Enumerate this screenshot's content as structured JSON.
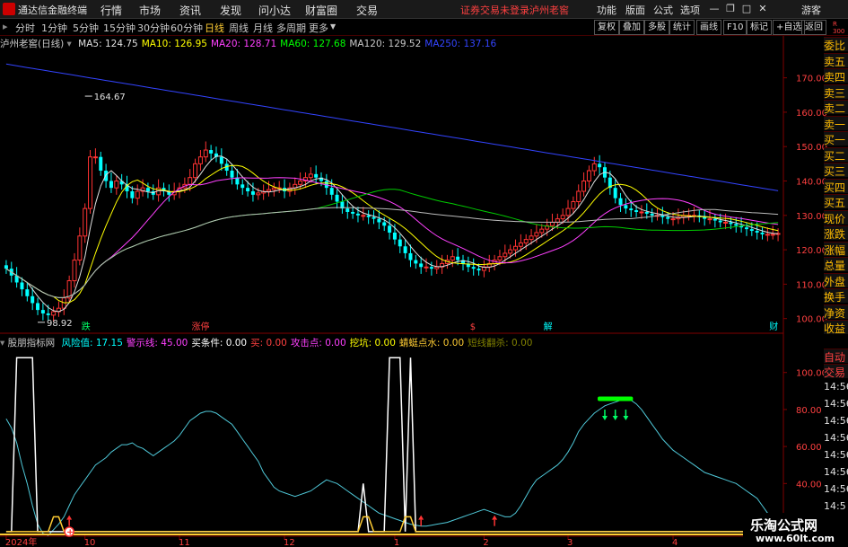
{
  "app": {
    "title": "通达信金融终端"
  },
  "menu": [
    "行情",
    "市场",
    "资讯",
    "发现",
    "问小达",
    "财富圈",
    "交易"
  ],
  "warning": {
    "text": "证券交易未登录",
    "stock": "泸州老窖"
  },
  "right_menu": [
    "功能",
    "版面",
    "公式",
    "选项"
  ],
  "user": "游客",
  "periods": [
    "分时",
    "1分钟",
    "5分钟",
    "15分钟",
    "30分钟",
    "60分钟",
    "日线",
    "周线",
    "月线",
    "多周期",
    "更多"
  ],
  "active_period": "日线",
  "tools": [
    "复权",
    "叠加",
    "多股",
    "统计",
    "画线",
    "F10",
    "标记",
    "+自选",
    "返回"
  ],
  "main_title": {
    "stock": "泸州老窖(日线)",
    "ma": [
      {
        "label": "MA5: 124.75",
        "color": "#e0e0e0"
      },
      {
        "label": "MA10: 126.95",
        "color": "#ffff00"
      },
      {
        "label": "MA20: 128.71",
        "color": "#ff40ff"
      },
      {
        "label": "MA60: 127.68",
        "color": "#00ff00"
      },
      {
        "label": "MA120: 129.52",
        "color": "#c8c8c8"
      },
      {
        "label": "MA250: 137.16",
        "color": "#3344ff"
      }
    ]
  },
  "indicator_title": {
    "name": "股朋指标网",
    "items": [
      {
        "label": "风险值: 17.15",
        "color": "#00ffff"
      },
      {
        "label": "警示线: 45.00",
        "color": "#ff40ff"
      },
      {
        "label": "买条件: 0.00",
        "color": "#ffffff"
      },
      {
        "label": "买: 0.00",
        "color": "#ff4040"
      },
      {
        "label": "攻击点: 0.00",
        "color": "#ff40ff"
      },
      {
        "label": "挖坑: 0.00",
        "color": "#ffff00"
      },
      {
        "label": "蜻蜓点水: 0.00",
        "color": "#ffcc33"
      },
      {
        "label": "短线翻杀: 0.00",
        "color": "#808000"
      }
    ]
  },
  "right_panel": [
    "委比",
    "卖五",
    "卖四",
    "卖三",
    "卖二",
    "卖一",
    "买一",
    "买二",
    "买三",
    "买四",
    "买五",
    "现价",
    "涨跌",
    "涨幅",
    "总量",
    "外盘",
    "换手",
    "净资",
    "收益",
    "自动",
    "交易"
  ],
  "right_panel_red": "R 300",
  "right_times": [
    "14:56",
    "14:56",
    "14:56",
    "14:56",
    "14:56",
    "14:56",
    "14:56",
    "14:5"
  ],
  "brand": {
    "name": "乐淘公式网",
    "url": "www.60lt.com"
  },
  "chart_data": [
    {
      "type": "candlestick",
      "title": "泸州老窖(日线)",
      "ylim": [
        96,
        178
      ],
      "yticks": [
        100.0,
        110.0,
        120.0,
        130.0,
        140.0,
        150.0,
        160.0,
        170.0
      ],
      "x_labels": [
        {
          "text": "2024年",
          "index": 0
        },
        {
          "text": "10",
          "index": 15
        },
        {
          "text": "11",
          "index": 33
        },
        {
          "text": "12",
          "index": 53
        },
        {
          "text": "1",
          "index": 74
        },
        {
          "text": "2",
          "index": 91
        },
        {
          "text": "3",
          "index": 107
        },
        {
          "text": "4",
          "index": 127
        }
      ],
      "annotations": [
        {
          "text": "164.67",
          "index": 15
        },
        {
          "text": "98.92",
          "index": 6
        }
      ],
      "markers": [
        {
          "text": "跌",
          "index": 15,
          "color": "#00ff66"
        },
        {
          "text": "涨停",
          "index": 36,
          "color": "#ff4040"
        },
        {
          "text": "$",
          "index": 89,
          "color": "#ff4040"
        },
        {
          "text": "解",
          "index": 103,
          "color": "#00ffff"
        },
        {
          "text": "财",
          "index": 146,
          "color": "#00ffff"
        }
      ],
      "closes": [
        114.5,
        112.5,
        110.5,
        108.5,
        106.5,
        104.5,
        102.5,
        101.5,
        101,
        102,
        103,
        106,
        111,
        117,
        124,
        132,
        147,
        147,
        143,
        140,
        138,
        140,
        139,
        137,
        135,
        137,
        138,
        137,
        136,
        138,
        137,
        136,
        137,
        138,
        139,
        141,
        145,
        147,
        149,
        148,
        147,
        145,
        143,
        141,
        139,
        138,
        137,
        136,
        136.5,
        137,
        137.5,
        138,
        138,
        137,
        138,
        139,
        140,
        141,
        142,
        141,
        140,
        138,
        136,
        134,
        132,
        131,
        130.5,
        130,
        130,
        129.5,
        129,
        128,
        127,
        125,
        123,
        121,
        119,
        117,
        116,
        115,
        115,
        114.5,
        115,
        116,
        117,
        118,
        117,
        116,
        115,
        114.5,
        114,
        115,
        116,
        117,
        118,
        119,
        120,
        121,
        122,
        123,
        124,
        125,
        126,
        127,
        128,
        129,
        130,
        132,
        134,
        137,
        140,
        143,
        145,
        144,
        141,
        138,
        135,
        133,
        132,
        131.5,
        131,
        131,
        130.5,
        130,
        130,
        129.5,
        129,
        129,
        129.5,
        130,
        130,
        130,
        129.5,
        129,
        129,
        128.5,
        128,
        128,
        127.5,
        127,
        126.5,
        126,
        125.5,
        125,
        124.5,
        124.5,
        124.5,
        124.75
      ]
    },
    {
      "type": "line",
      "title": "股朋指标网",
      "ylim": [
        12,
        112
      ],
      "yticks": [
        20.0,
        40.0,
        60.0,
        80.0,
        100.0
      ],
      "series": [
        {
          "name": "风险值",
          "color": "#4fc8d8",
          "values": [
            75,
            70,
            62,
            50,
            40,
            28,
            18,
            13,
            12,
            15,
            18,
            22,
            28,
            34,
            38,
            42,
            46,
            50,
            52,
            54,
            57,
            59,
            61,
            61,
            62,
            60,
            59,
            57,
            55,
            57,
            59,
            61,
            63,
            66,
            70,
            74,
            76,
            78,
            79,
            79,
            78,
            76,
            74,
            72,
            68,
            64,
            60,
            56,
            52,
            46,
            42,
            38,
            36,
            35,
            34,
            33,
            34,
            35,
            36,
            38,
            40,
            42,
            41,
            40,
            38,
            36,
            34,
            32,
            30,
            28,
            26,
            24,
            23,
            22,
            21,
            20,
            19,
            18,
            17.5,
            17,
            17,
            17.5,
            18,
            18.5,
            19,
            20,
            21,
            22,
            23,
            24,
            25,
            26,
            25,
            24,
            23,
            22,
            22,
            24,
            28,
            33,
            38,
            42,
            44,
            46,
            48,
            50,
            53,
            57,
            62,
            68,
            72,
            75,
            78,
            80,
            82,
            83,
            84,
            85,
            86,
            85,
            83,
            80,
            76,
            72,
            68,
            64,
            61,
            58,
            56,
            54,
            52,
            50,
            48,
            46,
            45,
            44,
            43,
            42,
            41,
            40,
            38,
            36,
            34,
            32,
            28,
            24,
            20,
            18,
            17.15
          ]
        },
        {
          "name": "警示线",
          "color": "#ffffff",
          "values": [
            0,
            0,
            0,
            0,
            0,
            0,
            0,
            0,
            0,
            0,
            0,
            0,
            0,
            0,
            0,
            0,
            0,
            0,
            0,
            0,
            0,
            0,
            0,
            0,
            0,
            0,
            0,
            0,
            0,
            0,
            0,
            0,
            0,
            0,
            0,
            0,
            0,
            0,
            0,
            0,
            0,
            0,
            0,
            0,
            0,
            0,
            0,
            0,
            0,
            0,
            0,
            0,
            0,
            0,
            0,
            0,
            0,
            0,
            0,
            0,
            0,
            0,
            0,
            0,
            0,
            0,
            0,
            0,
            0,
            0,
            0,
            0,
            0,
            0,
            0,
            0,
            0,
            0,
            0,
            0,
            0,
            0,
            0,
            0,
            0,
            0,
            0,
            0,
            0,
            0,
            0,
            0,
            0,
            0,
            0,
            0,
            0,
            0,
            0,
            0,
            0,
            0,
            0,
            0,
            0,
            0,
            0,
            0,
            0,
            0,
            0,
            0,
            0,
            0,
            0,
            0,
            0,
            0,
            0,
            0,
            0,
            0,
            0,
            0,
            0,
            0,
            0,
            0,
            0,
            0,
            0,
            0,
            0,
            0,
            0,
            0,
            0,
            0,
            0,
            0,
            0,
            0,
            0,
            0,
            0,
            0,
            0,
            0,
            0
          ]
        },
        {
          "name": "买条件",
          "color": "#ffffff",
          "values": [
            14,
            14,
            108,
            108,
            108,
            108,
            14,
            14,
            14,
            14,
            14,
            14,
            14,
            14,
            14,
            14,
            14,
            14,
            14,
            14,
            14,
            14,
            14,
            14,
            14,
            14,
            14,
            14,
            14,
            14,
            14,
            14,
            14,
            14,
            14,
            14,
            14,
            14,
            14,
            14,
            14,
            14,
            14,
            14,
            14,
            14,
            14,
            14,
            14,
            14,
            14,
            14,
            14,
            14,
            14,
            14,
            14,
            14,
            14,
            14,
            14,
            14,
            14,
            14,
            14,
            14,
            14,
            14,
            40,
            14,
            14,
            14,
            14,
            108,
            108,
            108,
            14,
            108,
            14,
            14,
            14,
            14,
            14,
            14,
            14,
            14,
            14,
            14,
            14,
            14,
            14,
            14,
            14,
            14,
            14,
            14,
            14,
            14,
            14,
            14,
            14,
            14,
            14,
            14,
            14,
            14,
            14,
            14,
            14,
            14,
            14,
            14,
            14,
            14,
            14,
            14,
            14,
            14,
            14,
            14,
            14,
            14,
            14,
            14,
            14,
            14,
            14,
            14,
            14,
            14,
            14,
            14,
            14,
            14,
            14,
            14,
            14,
            14,
            14,
            14,
            14,
            14,
            14,
            14,
            14,
            14,
            14,
            14,
            14
          ]
        },
        {
          "name": "蜻蜓点水",
          "color": "#ffcc33",
          "values": [
            14,
            14,
            14,
            14,
            14,
            14,
            14,
            14,
            14,
            22,
            22,
            14,
            14,
            14,
            14,
            14,
            14,
            14,
            14,
            14,
            14,
            14,
            14,
            14,
            14,
            14,
            14,
            14,
            14,
            14,
            14,
            14,
            14,
            14,
            14,
            14,
            14,
            14,
            14,
            14,
            14,
            14,
            14,
            14,
            14,
            14,
            14,
            14,
            14,
            14,
            14,
            14,
            14,
            14,
            14,
            14,
            14,
            14,
            14,
            14,
            14,
            14,
            14,
            14,
            14,
            14,
            14,
            14,
            22,
            22,
            14,
            14,
            14,
            14,
            14,
            14,
            22,
            22,
            14,
            14,
            14,
            14,
            14,
            14,
            14,
            14,
            14,
            14,
            14,
            14,
            14,
            14,
            14,
            14,
            14,
            14,
            14,
            14,
            14,
            14,
            14,
            14,
            14,
            14,
            14,
            14,
            14,
            14,
            14,
            14,
            14,
            14,
            14,
            14,
            14,
            14,
            14,
            14,
            14,
            14,
            14,
            14,
            14,
            14,
            14,
            14,
            14,
            14,
            14,
            14,
            14,
            14,
            14,
            14,
            14,
            14,
            14,
            14,
            14,
            14,
            14,
            14,
            14,
            14,
            14,
            14,
            14,
            14,
            14
          ]
        }
      ],
      "buy_arrows": [
        12,
        79,
        93
      ],
      "sell_arrows": [
        114,
        116,
        118
      ]
    }
  ]
}
